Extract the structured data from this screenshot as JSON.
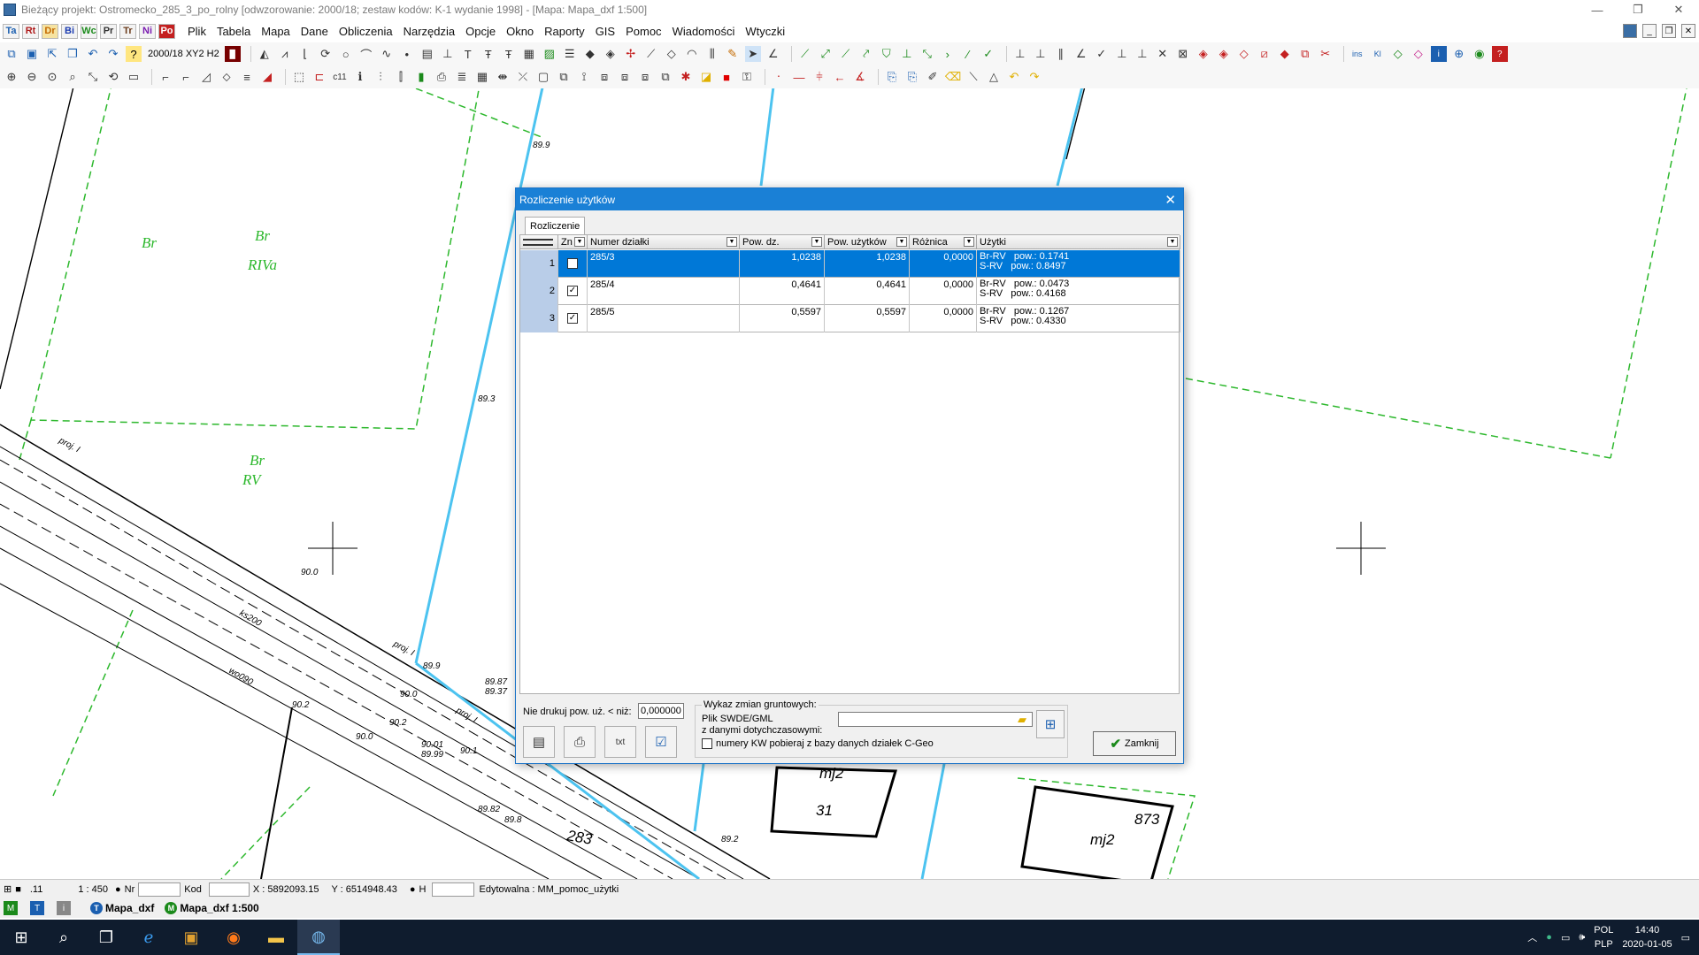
{
  "window": {
    "title": "Bieżący projekt: Ostromecko_285_3_po_rolny [odwzorowanie: 2000/18; zestaw kodów: K-1 wydanie 1998] - [Mapa: Mapa_dxf  1:500]",
    "minimize": "—",
    "restore": "❐",
    "close": "✕"
  },
  "modules": [
    "Ta",
    "Rt",
    "Dr",
    "Bi",
    "Wc",
    "Pr",
    "Tr",
    "Ni",
    "Po"
  ],
  "menu": [
    "Plik",
    "Tabela",
    "Mapa",
    "Dane",
    "Obliczenia",
    "Narzędzia",
    "Opcje",
    "Okno",
    "Raporty",
    "GIS",
    "Pomoc",
    "Wiadomości",
    "Wtyczki"
  ],
  "toolbar": {
    "coord_system": "2000/18 XY2 H2"
  },
  "map_labels": {
    "br1": "Br",
    "br2": "Br",
    "rivа": "RIVa",
    "br3": "Br",
    "rv": "RV",
    "h893": "89.3",
    "h899": "89.9",
    "h900a": "90.0",
    "h900b": "90.0",
    "h900c": "90.0",
    "h902a": "90.2",
    "h902b": "90.2",
    "h9001": "90.01",
    "h8939": "89.99",
    "h901": "90.1",
    "h8987": "89.87",
    "h8937": "89.37",
    "h8982": "89.82",
    "h898": "89.8",
    "h892": "89.2",
    "h899t": "89.9",
    "proj1": "proj. I",
    "proj2": "proj. I",
    "proj3": "proj. I",
    "ks200": "ks200",
    "wo090": "wo090",
    "n283": "283",
    "mj2a": "mj2",
    "mj2b": "mj2",
    "n31": "31",
    "n873": "873"
  },
  "dialog": {
    "title": "Rozliczenie użytków",
    "tab": "Rozliczenie",
    "columns": {
      "zn": "Zn",
      "numer": "Numer działki",
      "pow_dz": "Pow. dz.",
      "pow_uz": "Pow. użytków",
      "roznica": "Różnica",
      "uzytki": "Użytki"
    },
    "rows": [
      {
        "nr": "1",
        "checked": "",
        "numer": "285/3",
        "pow_dz": "1,0238",
        "pow_uz": "1,0238",
        "roznica": "0,0000",
        "uzytki": "Br-RV   pow.: 0.1741\nS-RV   pow.: 0.8497"
      },
      {
        "nr": "2",
        "checked": "✓",
        "numer": "285/4",
        "pow_dz": "0,4641",
        "pow_uz": "0,4641",
        "roznica": "0,0000",
        "uzytki": "Br-RV   pow.: 0.0473\nS-RV   pow.: 0.4168"
      },
      {
        "nr": "3",
        "checked": "✓",
        "numer": "285/5",
        "pow_dz": "0,5597",
        "pow_uz": "0,5597",
        "roznica": "0,0000",
        "uzytki": "Br-RV   pow.: 0.1267\nS-RV   pow.: 0.4330"
      }
    ],
    "nie_drukuj_label": "Nie drukuj pow. uż. < niż:",
    "nie_drukuj_value": "0,000000",
    "wykaz_label": "Wykaz zmian gruntowych:",
    "plik_label": "Plik SWDE/GML",
    "plik_label2": "z danymi dotychczasowymi:",
    "kw_label": "numery KW pobieraj z bazy danych działek C-Geo",
    "zamknij": "Zamknij"
  },
  "status": {
    "layer": ".11",
    "scale": "1 : 450",
    "nr_label": "Nr",
    "kod_label": "Kod",
    "x": "X : 5892093.15",
    "y": "Y : 6514948.43",
    "h_label": "H",
    "edit": "Edytowalna : MM_pomoc_użytki"
  },
  "doc_tabs": [
    {
      "badge": "T",
      "label": "Mapa_dxf"
    },
    {
      "badge": "M",
      "label": "Mapa_dxf  1:500"
    }
  ],
  "tray": {
    "lang1": "POL",
    "lang2": "PLP",
    "time": "14:40",
    "date": "2020-01-05"
  },
  "colors": {
    "accent": "#1a80d6",
    "parcel_line": "#4cc3f0",
    "usage_line": "#2db82d",
    "selection": "#0078d7"
  }
}
